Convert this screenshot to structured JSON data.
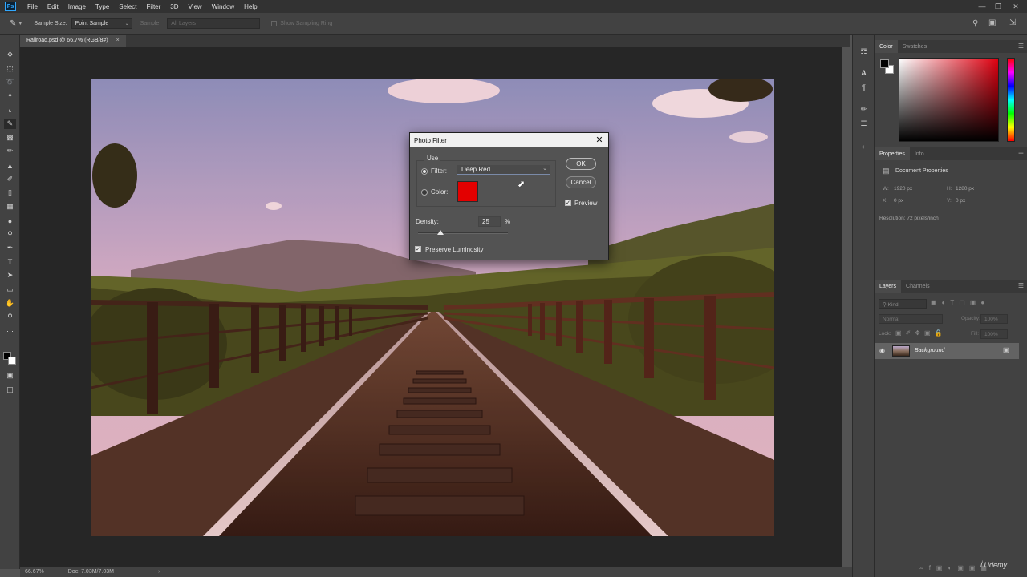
{
  "menubar": {
    "logo": "Ps",
    "items": [
      "File",
      "Edit",
      "Image",
      "Type",
      "Select",
      "Filter",
      "3D",
      "View",
      "Window",
      "Help"
    ]
  },
  "options": {
    "sample_size_label": "Sample Size:",
    "sample_size_value": "Point Sample",
    "sample_label": "Sample:",
    "sample_value": "All Layers",
    "show_ring_label": "Show Sampling Ring"
  },
  "document_tab": "Railroad.psd @ 66.7% (RGB/8#)",
  "status": {
    "zoom": "66.67%",
    "doc": "Doc: 7.03M/7.03M"
  },
  "color_panel": {
    "tabs": [
      "Color",
      "Swatches"
    ]
  },
  "properties_panel": {
    "tabs": [
      "Properties",
      "Info"
    ],
    "title": "Document Properties",
    "w_label": "W:",
    "w_value": "1920 px",
    "h_label": "H:",
    "h_value": "1280 px",
    "x_label": "X:",
    "x_value": "0 px",
    "y_label": "Y:",
    "y_value": "0 px",
    "resolution": "Resolution: 72 pixels/inch"
  },
  "layers_panel": {
    "tabs": [
      "Layers",
      "Channels"
    ],
    "kind": "Kind",
    "blend": "Normal",
    "opacity_label": "Opacity:",
    "opacity_value": "100%",
    "lock_label": "Lock:",
    "fill_label": "Fill:",
    "fill_value": "100%",
    "layer_name": "Background"
  },
  "dialog": {
    "title": "Photo Filter",
    "use_label": "Use",
    "filter_label": "Filter:",
    "filter_value": "Deep Red",
    "color_label": "Color:",
    "swatch_color": "#e30000",
    "density_label": "Density:",
    "density_value": "25",
    "density_unit": "%",
    "density_level": 0.25,
    "preserve_label": "Preserve Luminosity",
    "ok_label": "OK",
    "cancel_label": "Cancel",
    "preview_label": "Preview"
  },
  "watermark": "Udemy",
  "colors": {
    "accent": "#31a8ff",
    "swatch_red": "#e30000"
  }
}
